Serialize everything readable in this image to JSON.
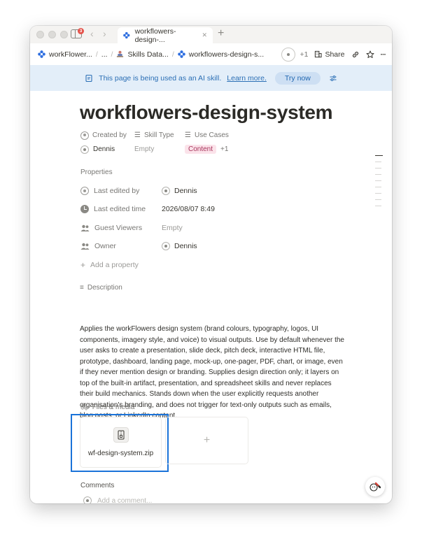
{
  "browser": {
    "notification_count": "3",
    "active_tab_title": "workflowers-design-...",
    "new_tab_symbol": "+"
  },
  "breadcrumb": {
    "items": [
      "workFlower...",
      "...",
      "Skills Data...",
      "workflowers-design-s..."
    ],
    "separator": "/"
  },
  "topbar": {
    "presence_extra": "+1",
    "share_label": "Share",
    "more_symbol": "···"
  },
  "banner": {
    "message": "This page is being used as an AI skill.",
    "link_text": "Learn more.",
    "button_label": "Try now"
  },
  "page": {
    "title": "workflowers-design-system"
  },
  "header_props": {
    "created_by": {
      "label": "Created by",
      "value": "Dennis"
    },
    "skill_type": {
      "label": "Skill Type",
      "value": "Empty"
    },
    "use_cases": {
      "label": "Use Cases",
      "value": "Content",
      "extra": "+1"
    }
  },
  "properties": {
    "section_label": "Properties",
    "rows": [
      {
        "name": "Last edited by",
        "value": "Dennis"
      },
      {
        "name": "Last edited time",
        "value": "2026/08/07 8:49"
      },
      {
        "name": "Guest Viewers",
        "value": "Empty"
      },
      {
        "name": "Owner",
        "value": "Dennis"
      }
    ],
    "add_label": "Add a property"
  },
  "description": {
    "label": "Description",
    "text": "Applies the workFlowers design system (brand colours, typography, logos, UI components, imagery style, and voice) to visual outputs. Use by default whenever the user asks to create a presentation, slide deck, pitch deck, interactive HTML file, prototype, dashboard, landing page, mock-up, one-pager, PDF, chart, or image, even if they never mention design or branding. Supplies design direction only; it layers on top of the built-in artifact, presentation, and spreadsheet skills and never replaces their build mechanics. Stands down when the user explicitly requests another organisation's branding, and does not trigger for text-only outputs such as emails, blog posts, or LinkedIn content."
  },
  "files": {
    "label": "Files & media",
    "items": [
      {
        "name": "wf-design-system.zip"
      }
    ],
    "add_symbol": "+"
  },
  "comments": {
    "label": "Comments",
    "placeholder": "Add a comment..."
  },
  "icons": {
    "notion_page": "blue-flower-icon",
    "skills_db": "person-at-desk-icon"
  },
  "colors": {
    "banner_bg": "#e3eef9",
    "banner_text": "#2b6fb5",
    "tag_pink_bg": "#fbe3ea",
    "highlight": "#1a73d9",
    "badge": "#e5534b"
  }
}
